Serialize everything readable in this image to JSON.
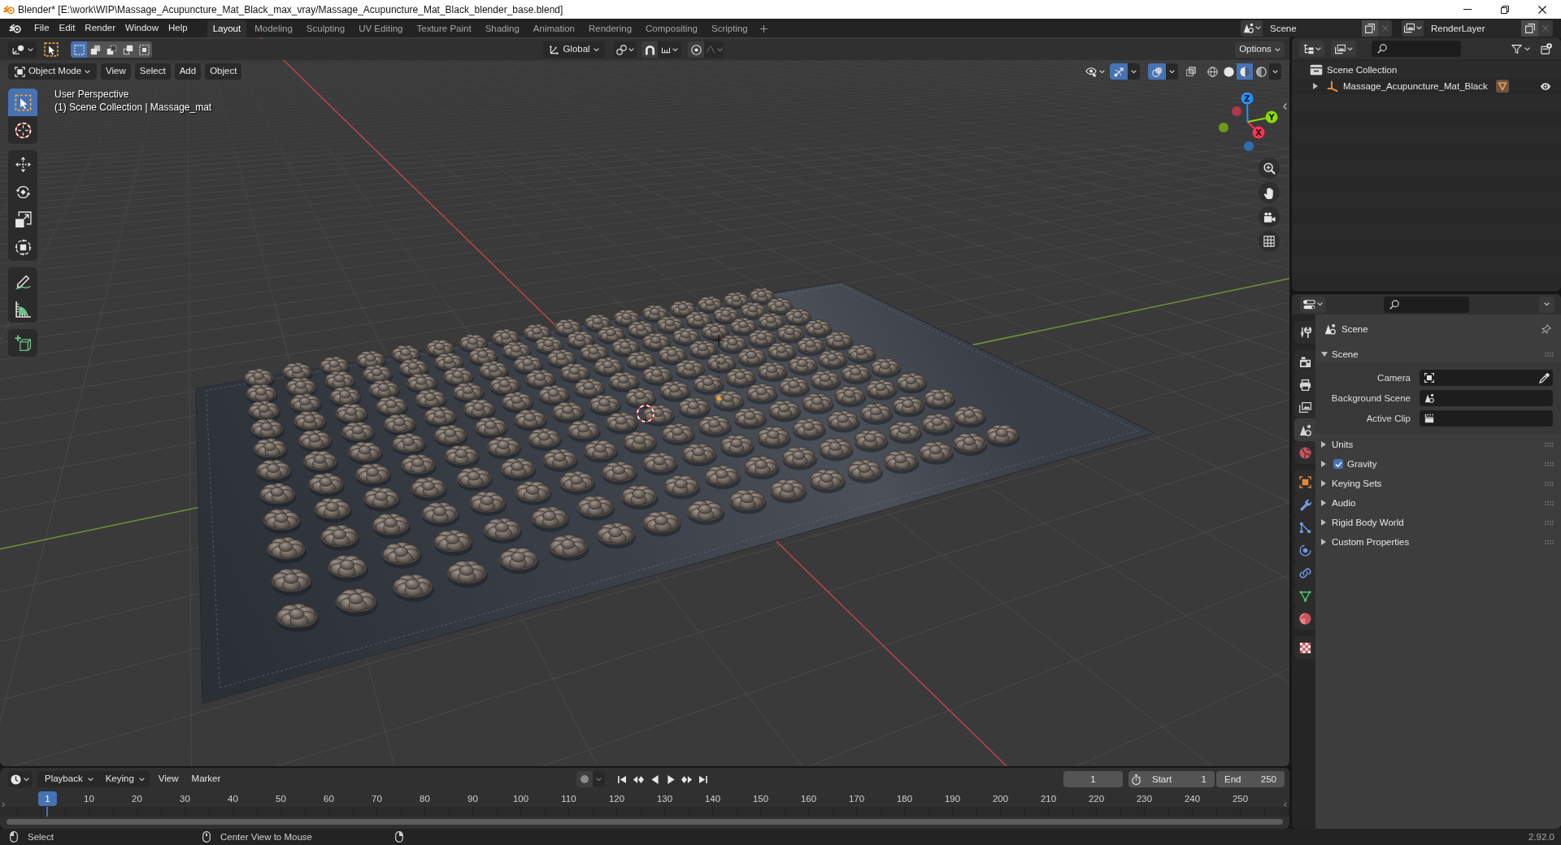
{
  "window": {
    "title": "Blender* [E:\\work\\WIP\\Massage_Acupuncture_Mat_Black_max_vray/Massage_Acupuncture_Mat_Black_blender_base.blend]"
  },
  "menu_bar": {
    "items": [
      "File",
      "Edit",
      "Render",
      "Window",
      "Help"
    ]
  },
  "workspace_tabs": [
    {
      "label": "Layout",
      "selected": true
    },
    {
      "label": "Modeling",
      "selected": false
    },
    {
      "label": "Sculpting",
      "selected": false
    },
    {
      "label": "UV Editing",
      "selected": false
    },
    {
      "label": "Texture Paint",
      "selected": false
    },
    {
      "label": "Shading",
      "selected": false
    },
    {
      "label": "Animation",
      "selected": false
    },
    {
      "label": "Rendering",
      "selected": false
    },
    {
      "label": "Compositing",
      "selected": false
    },
    {
      "label": "Scripting",
      "selected": false
    }
  ],
  "scene_selector": {
    "value": "Scene"
  },
  "view_layer_selector": {
    "value": "RenderLayer"
  },
  "viewport": {
    "tool_settings": {
      "select_modes": [
        {
          "kind": "set",
          "selected": true
        },
        {
          "kind": "extend",
          "selected": false
        },
        {
          "kind": "subtract",
          "selected": false
        },
        {
          "kind": "invert",
          "selected": false
        },
        {
          "kind": "intersect",
          "selected": false
        }
      ],
      "orientation": "Global",
      "proportional_editing": false,
      "options": "Options"
    },
    "header": {
      "mode": "Object Mode",
      "menus": [
        "View",
        "Select",
        "Add",
        "Object"
      ],
      "gizmos": true,
      "overlays": true,
      "xray": false,
      "shading": [
        {
          "kind": "wireframe",
          "selected": false
        },
        {
          "kind": "solid",
          "selected": false
        },
        {
          "kind": "material",
          "selected": true
        },
        {
          "kind": "rendered",
          "selected": false
        }
      ]
    },
    "info": [
      "User Perspective",
      "(1) Scene Collection | Massage_mat"
    ],
    "tools": [
      {
        "kind": "select_box",
        "selected": true
      },
      {
        "kind": "cursor",
        "selected": false
      },
      {
        "kind": "move",
        "selected": false
      },
      {
        "kind": "rotate",
        "selected": false
      },
      {
        "kind": "scale",
        "selected": false
      },
      {
        "kind": "transform",
        "selected": false
      },
      {
        "kind": "annotate",
        "selected": false
      },
      {
        "kind": "measure",
        "selected": false
      },
      {
        "kind": "add_cube",
        "selected": false
      }
    ],
    "gizmo_axes": [
      {
        "label": "X",
        "color": "#ff3352"
      },
      {
        "label": "Y",
        "color": "#8bdc00"
      },
      {
        "label": "Z",
        "color": "#2890ff"
      }
    ]
  },
  "outliner": {
    "items": [
      {
        "label": "Scene Collection",
        "children": [
          {
            "label": "Massage_Acupuncture_Mat_Black",
            "expanded": false,
            "visible": true
          }
        ]
      }
    ]
  },
  "properties": {
    "tabs": [
      {
        "kind": "tool",
        "selected": false
      },
      {
        "kind": "render",
        "selected": false
      },
      {
        "kind": "output",
        "selected": false
      },
      {
        "kind": "view_layer",
        "selected": false
      },
      {
        "kind": "scene",
        "selected": true
      },
      {
        "kind": "world",
        "selected": false
      },
      {
        "kind": "object",
        "selected": false
      },
      {
        "kind": "modifiers",
        "selected": false
      },
      {
        "kind": "particles",
        "selected": false
      },
      {
        "kind": "physics",
        "selected": false
      },
      {
        "kind": "constraints",
        "selected": false
      },
      {
        "kind": "data",
        "selected": false
      },
      {
        "kind": "material",
        "selected": false
      },
      {
        "kind": "texture",
        "selected": false
      }
    ],
    "context": "Scene",
    "panels": [
      {
        "title": "Scene",
        "expanded": true,
        "fields": [
          {
            "label": "Camera",
            "kind": "object"
          },
          {
            "label": "Background Scene",
            "kind": "scene"
          },
          {
            "label": "Active Clip",
            "kind": "clip"
          }
        ]
      },
      {
        "title": "Units",
        "expanded": false
      },
      {
        "title": "Gravity",
        "expanded": false,
        "checked": true
      },
      {
        "title": "Keying Sets",
        "expanded": false
      },
      {
        "title": "Audio",
        "expanded": false
      },
      {
        "title": "Rigid Body World",
        "expanded": false
      },
      {
        "title": "Custom Properties",
        "expanded": false
      }
    ]
  },
  "timeline": {
    "menus": [
      {
        "label": "Playback",
        "kind": "dropdown"
      },
      {
        "label": "Keying",
        "kind": "dropdown"
      },
      {
        "label": "View",
        "kind": "menu"
      },
      {
        "label": "Marker",
        "kind": "menu"
      }
    ],
    "auto_keying": false,
    "current_frame": "1",
    "start": {
      "label": "Start",
      "value": "1"
    },
    "end": {
      "label": "End",
      "value": "250"
    },
    "ruler": {
      "labels": [
        "10",
        "20",
        "30",
        "40",
        "50",
        "60",
        "70",
        "80",
        "90",
        "100",
        "110",
        "120",
        "130",
        "140",
        "150",
        "160",
        "170",
        "180",
        "190",
        "200",
        "210",
        "220",
        "230",
        "240",
        "250"
      ],
      "playhead": "1"
    }
  },
  "status_bar": {
    "hints": [
      {
        "kind": "left_click",
        "label": "Select"
      },
      {
        "kind": "middle_click",
        "label": "Center View to Mouse"
      },
      {
        "kind": "right_click"
      }
    ],
    "version": "2.92.0"
  }
}
